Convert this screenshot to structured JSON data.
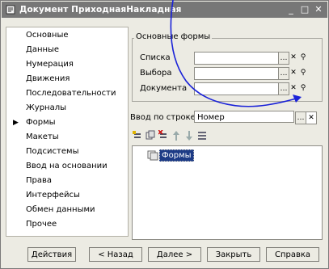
{
  "window": {
    "title": "Документ ПриходнаяНакладная"
  },
  "left_menu": {
    "items": [
      {
        "label": "Основные"
      },
      {
        "label": "Данные"
      },
      {
        "label": "Нумерация"
      },
      {
        "label": "Движения"
      },
      {
        "label": "Последовательности"
      },
      {
        "label": "Журналы"
      },
      {
        "label": "Формы",
        "selected": true
      },
      {
        "label": "Макеты"
      },
      {
        "label": "Подсистемы"
      },
      {
        "label": "Ввод на основании"
      },
      {
        "label": "Права"
      },
      {
        "label": "Интерфейсы"
      },
      {
        "label": "Обмен данными"
      },
      {
        "label": "Прочее"
      }
    ]
  },
  "main_forms": {
    "group_label": "Основные формы",
    "fields": [
      {
        "label": "Списка",
        "value": ""
      },
      {
        "label": "Выбора",
        "value": ""
      },
      {
        "label": "Документа",
        "value": ""
      }
    ]
  },
  "search": {
    "label": "Ввод по строке",
    "value": "Номер"
  },
  "tree": {
    "node_label": "Формы"
  },
  "buttons": {
    "actions": "Действия",
    "back": "< Назад",
    "next": "Далее >",
    "close": "Закрыть",
    "help": "Справка"
  },
  "icons": {
    "select": "ellipsis-icon",
    "clear": "clear-x-icon",
    "open": "magnifier-icon"
  },
  "colors": {
    "titlebar": "#777777",
    "window_bg": "#ecebe3",
    "selection": "#1d3b86",
    "annotation_curve": "#1a22d8"
  }
}
